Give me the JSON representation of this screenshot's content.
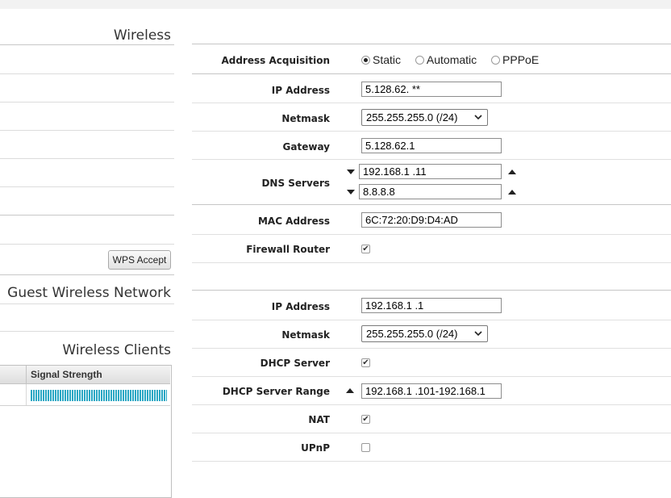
{
  "left": {
    "wireless_title": "Wireless",
    "wps_button_label": "WPS Accept",
    "guest_title": "Guest Wireless Network",
    "clients_title": "Wireless Clients",
    "clients_table": {
      "columns": [
        "",
        "Signal Strength"
      ],
      "rows": [
        {
          "signal_strength_fraction": 1.0
        }
      ]
    }
  },
  "wan": {
    "address_acquisition": {
      "label": "Address Acquisition",
      "options": [
        "Static",
        "Automatic",
        "PPPoE"
      ],
      "selected": "Static"
    },
    "ip_address": {
      "label": "IP Address",
      "value": "5.128.62.  **"
    },
    "netmask": {
      "label": "Netmask",
      "value": "255.255.255.0 (/24)"
    },
    "gateway": {
      "label": "Gateway",
      "value": "5.128.62.1"
    },
    "dns": {
      "label": "DNS Servers",
      "servers": [
        "192.168.1    .11",
        "8.8.8.8"
      ]
    },
    "mac_address": {
      "label": "MAC Address",
      "value": "6C:72:20:D9:D4:AD"
    },
    "firewall_router": {
      "label": "Firewall Router",
      "checked": true
    }
  },
  "lan": {
    "ip_address": {
      "label": "IP Address",
      "value": "192.168.1    .1"
    },
    "netmask": {
      "label": "Netmask",
      "value": "255.255.255.0 (/24)"
    },
    "dhcp_server": {
      "label": "DHCP Server",
      "checked": true
    },
    "dhcp_range": {
      "label": "DHCP Server Range",
      "value": "192.168.1    .101-192.168.1"
    },
    "nat": {
      "label": "NAT",
      "checked": true
    },
    "upnp": {
      "label": "UPnP",
      "checked": false
    }
  },
  "icons": {
    "checkmark": "✔",
    "arrow_down": "triangle-down",
    "arrow_up": "triangle-up",
    "chevron": "chevron-down"
  },
  "colors": {
    "signal_bar": "#2aa7c4",
    "section_title": "#333333"
  }
}
